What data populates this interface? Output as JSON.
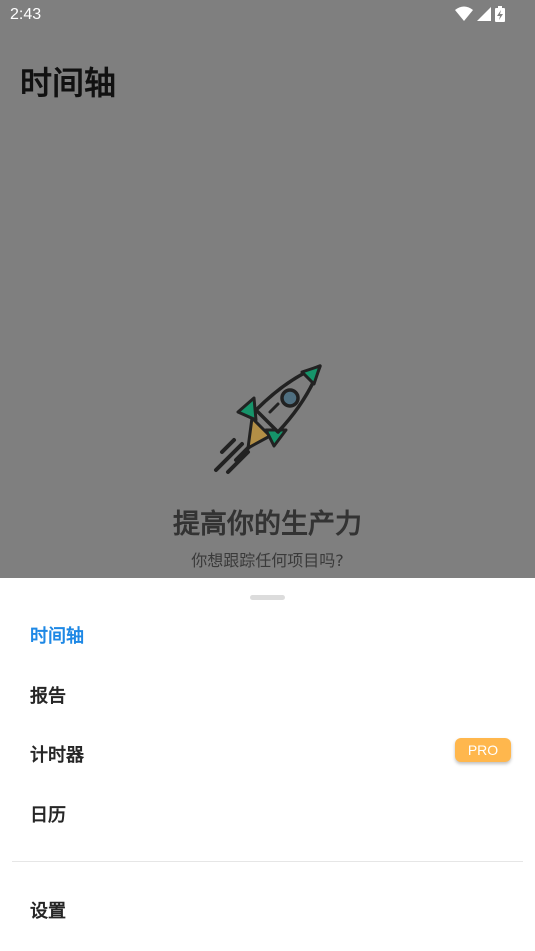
{
  "status_bar": {
    "time": "2:43"
  },
  "page": {
    "title": "时间轴"
  },
  "empty_state": {
    "title": "提高你的生产力",
    "subtitle": "你想跟踪任何项目吗?"
  },
  "menu": {
    "items": [
      {
        "label": "时间轴",
        "active": true
      },
      {
        "label": "报告"
      },
      {
        "label": "计时器",
        "badge": "PRO"
      },
      {
        "label": "日历"
      }
    ],
    "settings": {
      "label": "设置"
    }
  },
  "colors": {
    "accent": "#1e88e5",
    "pro_badge": "#ffb74d",
    "overlay": "#7f7f7f",
    "rocket_green": "#16946a",
    "rocket_flame": "#b38f46"
  }
}
